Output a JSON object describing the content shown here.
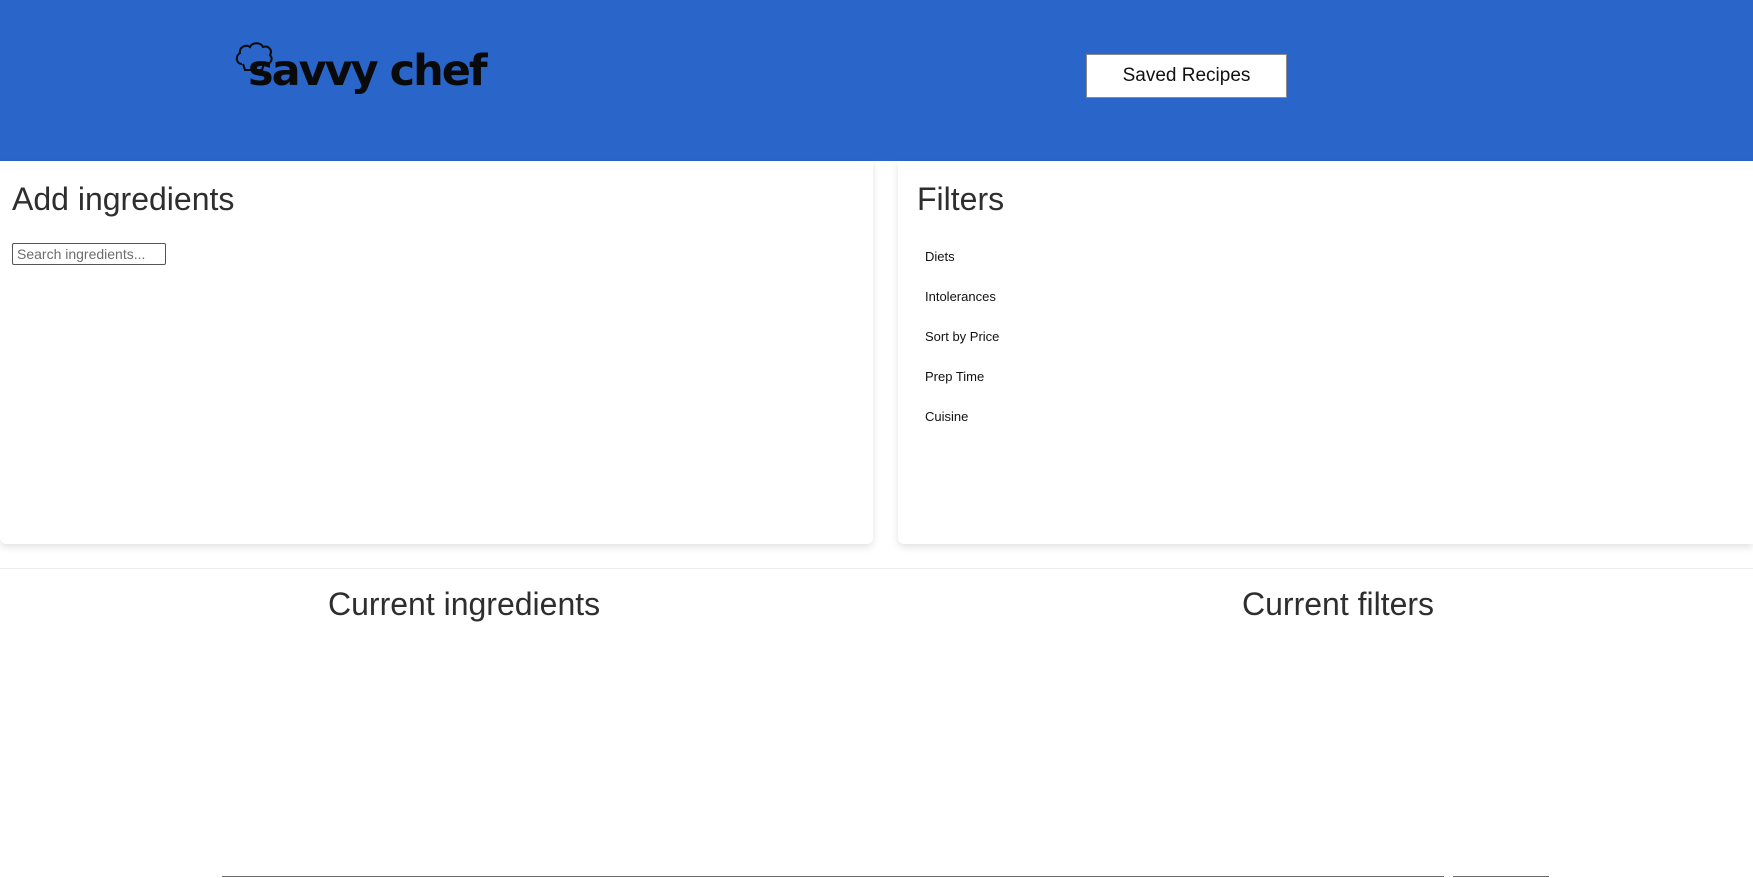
{
  "header": {
    "logo_text": "savvy chef",
    "saved_recipes_label": "Saved Recipes",
    "background_color": "#2a66c9"
  },
  "add_ingredients": {
    "title": "Add ingredients",
    "search_placeholder": "Search ingredients..."
  },
  "filters": {
    "title": "Filters",
    "items": [
      {
        "label": "Diets"
      },
      {
        "label": "Intolerances"
      },
      {
        "label": "Sort by Price"
      },
      {
        "label": "Prep Time"
      },
      {
        "label": "Cuisine"
      }
    ]
  },
  "current": {
    "ingredients_title": "Current ingredients",
    "filters_title": "Current filters"
  }
}
